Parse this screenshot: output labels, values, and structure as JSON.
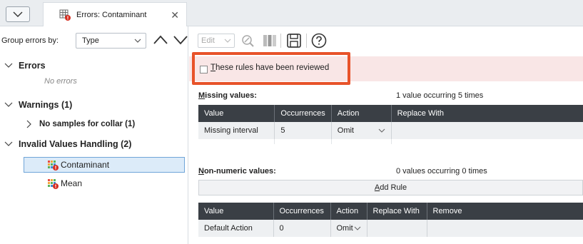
{
  "tab": {
    "title": "Errors: Contaminant"
  },
  "left": {
    "group_by_label": "Group errors by:",
    "group_by_value": "Type",
    "tree": {
      "errors": {
        "label": "Errors",
        "empty_text": "No errors"
      },
      "warnings": {
        "label": "Warnings (1)",
        "child": "No samples for collar (1)"
      },
      "invalid": {
        "label": "Invalid Values Handling (2)",
        "items": [
          "Contaminant",
          "Mean"
        ]
      }
    }
  },
  "toolbar": {
    "edit_label": "Edit"
  },
  "review": {
    "label_prefix": "T",
    "label_rest": "hese rules have been reviewed"
  },
  "missing": {
    "label_prefix": "M",
    "label_rest": "issing values:",
    "info": "1 value occurring 5 times",
    "headers": [
      "Value",
      "Occurrences",
      "Action",
      "Replace With"
    ],
    "rows": [
      {
        "value": "Missing interval",
        "occurrences": "5",
        "action": "Omit",
        "replace": ""
      }
    ]
  },
  "nonnumeric": {
    "label_prefix": "N",
    "label_rest": "on-numeric values:",
    "info": "0 values occurring 0 times",
    "add_rule_prefix": "A",
    "add_rule_rest": "dd Rule",
    "headers": [
      "Value",
      "Occurrences",
      "Action",
      "Replace With",
      "Remove"
    ],
    "rows": [
      {
        "value": "Default Action",
        "occurrences": "0",
        "action": "Omit",
        "replace": "",
        "remove": ""
      }
    ]
  },
  "colors": {
    "callout": "#e8532a",
    "review_bg": "#f9e6e6",
    "header_bg": "#3a3f45",
    "selection": "#dcebf9"
  }
}
